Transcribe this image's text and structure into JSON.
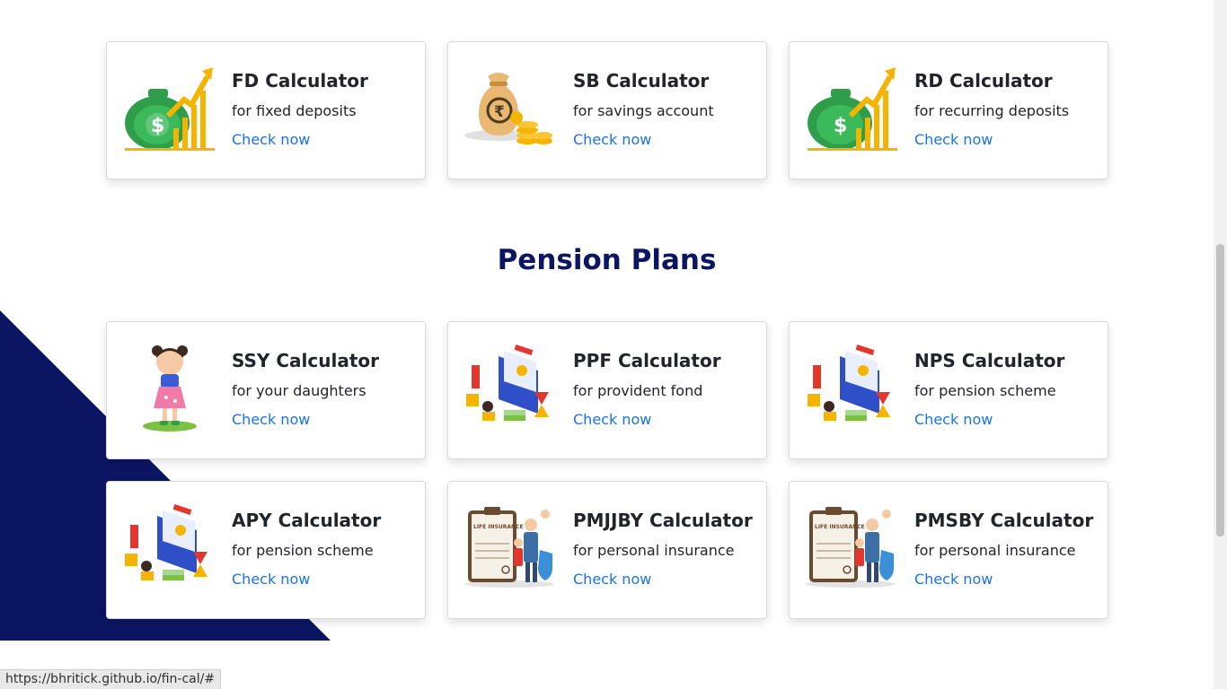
{
  "section": {
    "title": "Pension Plans"
  },
  "cards": [
    {
      "title": "FD Calculator",
      "subtitle": "for fixed deposits",
      "link": "Check now",
      "icon": "money-bag-growth-icon"
    },
    {
      "title": "SB Calculator",
      "subtitle": "for savings account",
      "link": "Check now",
      "icon": "rupee-bag-coins-icon"
    },
    {
      "title": "RD Calculator",
      "subtitle": "for recurring deposits",
      "link": "Check now",
      "icon": "money-bag-growth-icon"
    },
    {
      "title": "SSY Calculator",
      "subtitle": "for your daughters",
      "link": "Check now",
      "icon": "girl-child-icon"
    },
    {
      "title": "PPF Calculator",
      "subtitle": "for provident fond",
      "link": "Check now",
      "icon": "savings-isometric-icon"
    },
    {
      "title": "NPS Calculator",
      "subtitle": "for pension scheme",
      "link": "Check now",
      "icon": "savings-isometric-icon"
    },
    {
      "title": "APY Calculator",
      "subtitle": "for pension scheme",
      "link": "Check now",
      "icon": "savings-isometric-icon"
    },
    {
      "title": "PMJJBY Calculator",
      "subtitle": "for personal insurance",
      "link": "Check now",
      "icon": "life-insurance-icon"
    },
    {
      "title": "PMSBY Calculator",
      "subtitle": "for personal insurance",
      "link": "Check now",
      "icon": "life-insurance-icon"
    }
  ],
  "insurance_label": "LIFE INSURANCE",
  "status_url": "https://bhritick.github.io/fin-cal/#",
  "colors": {
    "brand_navy": "#0b1562",
    "link": "#1a73e8"
  }
}
